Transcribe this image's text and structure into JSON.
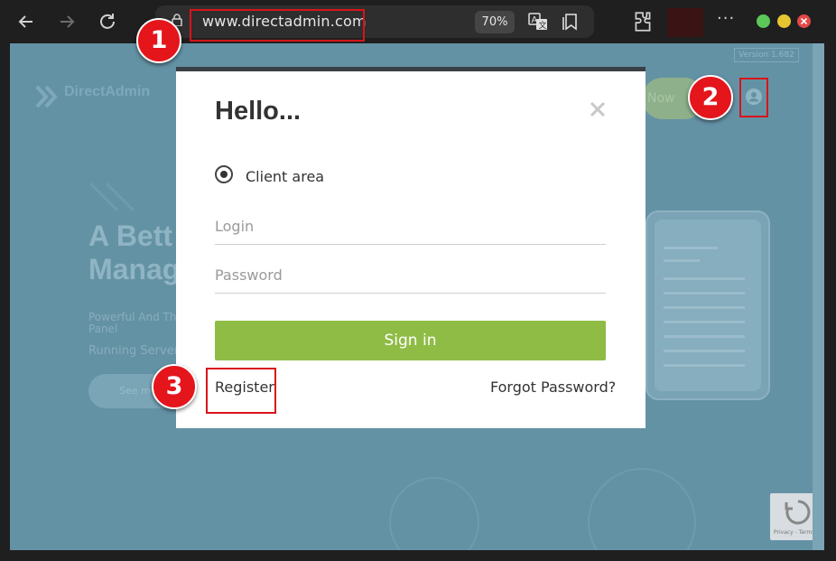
{
  "browser": {
    "url": "www.directadmin.com",
    "zoom": "70%",
    "nav_icons": [
      "back-arrow-icon",
      "forward-arrow-icon",
      "reload-icon"
    ],
    "address_icons": [
      "lock-icon",
      "translate-icon",
      "reading-list-icon"
    ],
    "toolbar_icons": [
      "extensions-icon",
      "more-icon"
    ],
    "window_dots": [
      "#5cc85a",
      "#e6c532",
      "#e44848"
    ]
  },
  "background": {
    "logo": "DirectAdmin",
    "version": "Version 1.682",
    "cta": "Now",
    "headline": [
      "A Bett",
      "Manag"
    ],
    "paragraph": [
      "Powerful And Th",
      "Panel"
    ],
    "paragraph2": "Running Server",
    "see_more": "See m",
    "recaptcha": "Privacy - Terms"
  },
  "modal": {
    "title": "Hello...",
    "radio_label": "Client area",
    "login_placeholder": "Login",
    "password_placeholder": "Password",
    "signin_label": "Sign in",
    "register_label": "Register",
    "forgot_label": "Forgot Password?"
  },
  "annotations": {
    "badge1": "1",
    "badge2": "2",
    "badge3": "3"
  },
  "colors": {
    "accent_green": "#8fbc45",
    "annotation_red": "#e4151b",
    "page_overlay": "#6492a5"
  }
}
